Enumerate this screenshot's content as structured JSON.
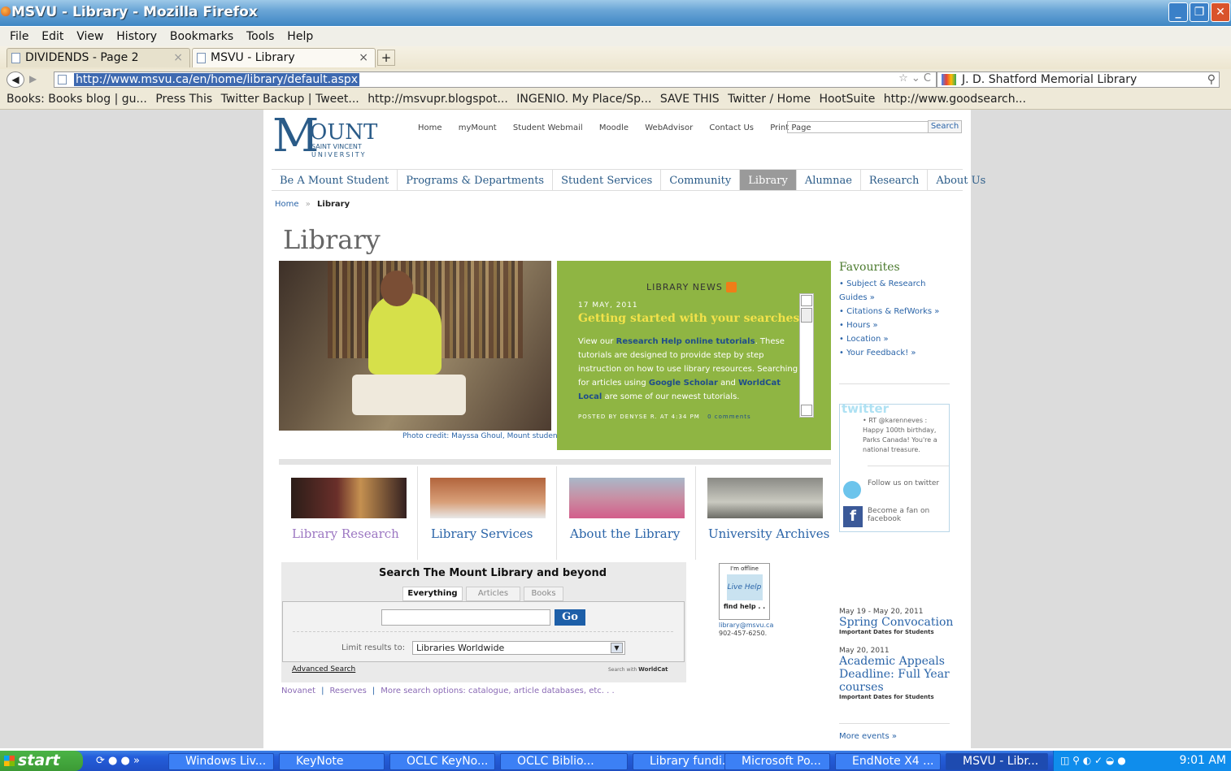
{
  "window": {
    "title": "MSVU - Library - Mozilla Firefox"
  },
  "menu": [
    "File",
    "Edit",
    "View",
    "History",
    "Bookmarks",
    "Tools",
    "Help"
  ],
  "tabs": [
    {
      "label": "DIVIDENDS - Page 2"
    },
    {
      "label": "MSVU - Library"
    }
  ],
  "url": "http://www.msvu.ca/en/home/library/default.aspx",
  "browser_search": "J. D. Shatford Memorial Library",
  "bookmarks": [
    "Books: Books blog | gu...",
    "Press This",
    "Twitter Backup | Tweet...",
    "http://msvupr.blogspot...",
    "INGENIO. My Place/Sp...",
    "SAVE THIS",
    "Twitter / Home",
    "HootSuite",
    "http://www.goodsearch..."
  ],
  "logo": {
    "big": "OUNT",
    "m": "M",
    "line1": "SAINT VINCENT",
    "line2": "UNIVERSITY"
  },
  "toplinks": [
    "Home",
    "myMount",
    "Student Webmail",
    "Moodle",
    "WebAdvisor",
    "Contact Us",
    "Print Page"
  ],
  "site_search_button": "Search",
  "mainnav": [
    "Be A Mount Student",
    "Programs & Departments",
    "Student Services",
    "Community",
    "Library",
    "Alumnae",
    "Research",
    "About Us"
  ],
  "breadcrumb": {
    "home": "Home",
    "sep": "»",
    "current": "Library"
  },
  "page_title": "Library",
  "photo_credit": "Photo credit: Mayssa Ghoul, Mount student",
  "news": {
    "heading": "LIBRARY NEWS",
    "date": "17 MAY, 2011",
    "title": "Getting started with your searches",
    "p1": "View our ",
    "link1": "Research Help online tutorials",
    "p2": ". These tutorials are designed to provide step by step instruction on how to use library resources. Searching for articles using ",
    "link2": "Google Scholar",
    "p3": " and ",
    "link3": "WorldCat Local",
    "p4": " are some of our newest tutorials.",
    "posted": "POSTED BY DENYSE R. AT 4:34 PM",
    "comments": "0 comments"
  },
  "tiles": [
    {
      "label": "Library Research"
    },
    {
      "label": "Library Services"
    },
    {
      "label": "About the Library"
    },
    {
      "label": "University Archives"
    }
  ],
  "search": {
    "title": "Search The Mount Library and beyond",
    "tabs": [
      "Everything",
      "Articles",
      "Books"
    ],
    "go": "Go",
    "limit_label": "Limit results to:",
    "limit_value": "Libraries Worldwide",
    "advanced": "Advanced Search",
    "search_with": "Search with",
    "worldcat": "WorldCat"
  },
  "search_links": [
    "Novanet",
    "Reserves",
    "More search options: catalogue, article databases, etc. . ."
  ],
  "livehelp": {
    "status": "I'm offline",
    "logo": "Live Help",
    "find": "find help . .",
    "email": "library@msvu.ca",
    "phone": "902-457-6250."
  },
  "favourites": {
    "heading": "Favourites",
    "items": [
      "Subject & Research Guides »",
      "Citations & RefWorks »",
      "Hours »",
      "Location »",
      "Your Feedback! »"
    ]
  },
  "twitter": {
    "logo": "twitter",
    "tweet": "RT @karenneves : Happy 100th birthday, Parks Canada! You're a national treasure.",
    "follow": "Follow us on twitter",
    "fan": "Become a fan on facebook"
  },
  "events": [
    {
      "date": "May 19 - May 20, 2011",
      "title": "Spring Convocation",
      "sub": "Important Dates for Students"
    },
    {
      "date": "May 20, 2011",
      "title": "Academic Appeals Deadline: Full Year courses",
      "sub": "Important Dates for Students"
    }
  ],
  "more_events": "More events »",
  "taskbar": {
    "start": "start",
    "tasks": [
      "Windows Liv...",
      "KeyNote",
      "OCLC KeyNo...",
      "OCLC Biblio...",
      "Library fundi...",
      "Microsoft Po...",
      "EndNote X4 ...",
      "MSVU - Libr..."
    ],
    "clock": "9:01 AM"
  },
  "colors": {
    "news_bg": "#8fb543",
    "nav_active": "#9a9a9a",
    "link": "#2a64a8",
    "taskbar": "#245edb"
  }
}
